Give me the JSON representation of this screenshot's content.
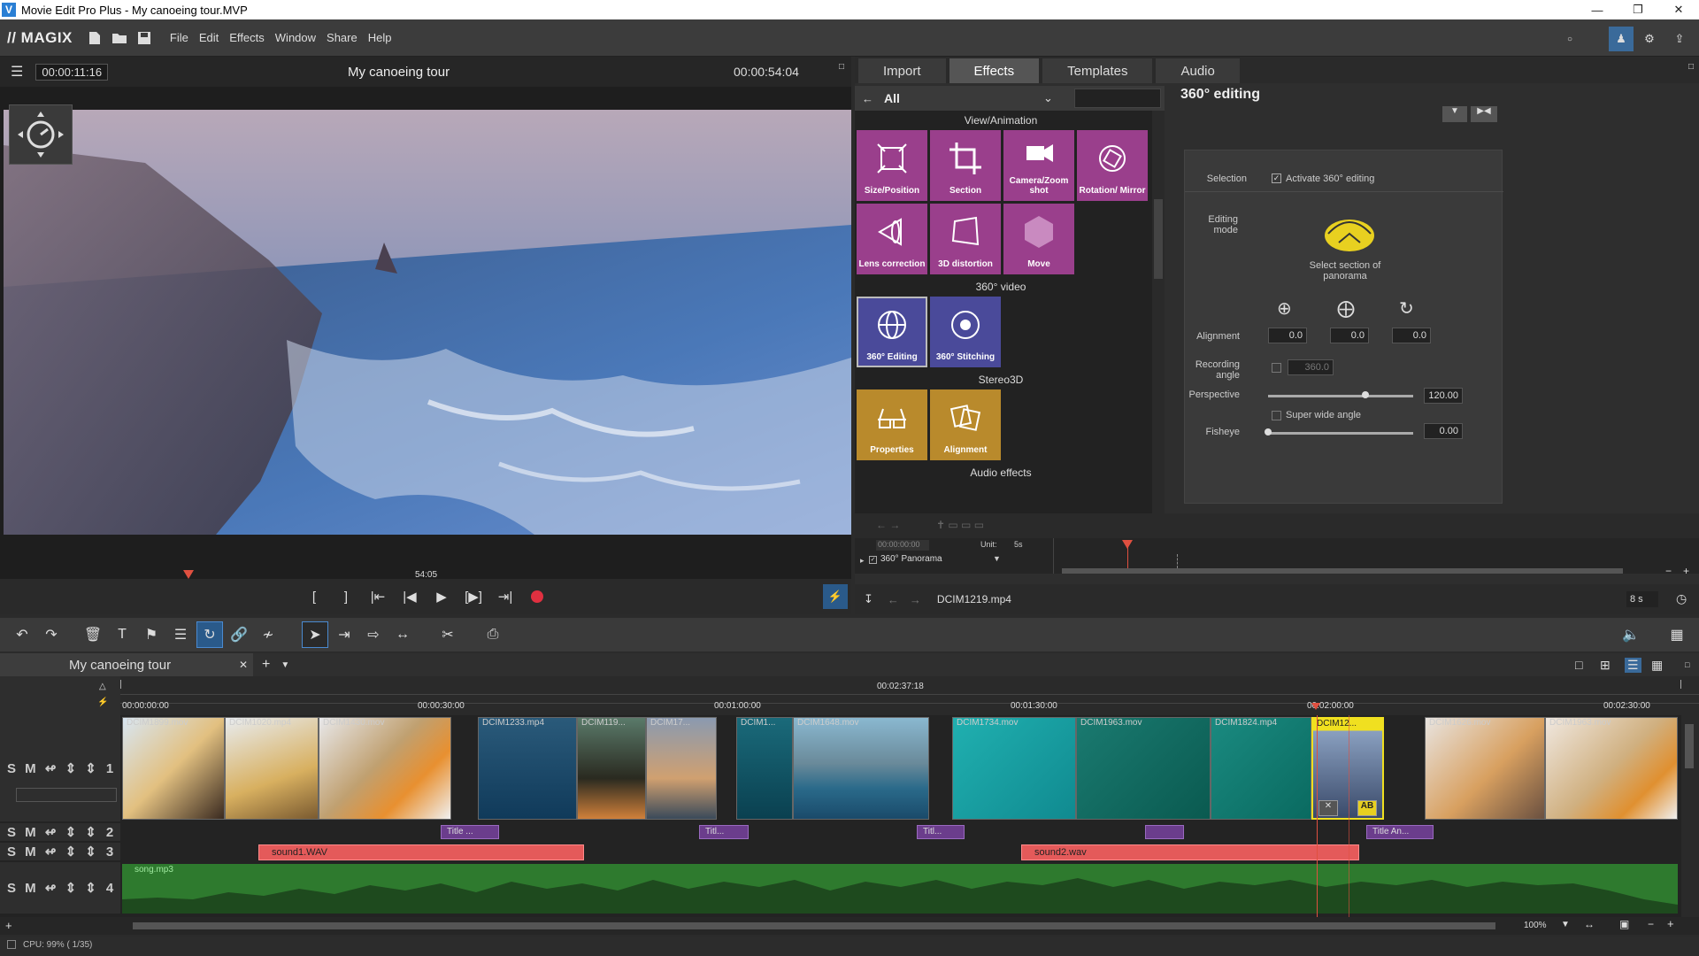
{
  "window": {
    "title": "Movie Edit Pro Plus - My canoeing tour.MVP"
  },
  "menu": {
    "logo": "// MAGIX",
    "items": [
      "File",
      "Edit",
      "Effects",
      "Window",
      "Share",
      "Help"
    ]
  },
  "preview": {
    "timecode_left": "00:00:11:16",
    "title": "My canoeing tour",
    "timecode_right": "00:00:54:04",
    "scrub_label": "54:05"
  },
  "media_tabs": [
    "Import",
    "Effects",
    "Templates",
    "Audio"
  ],
  "effects": {
    "category": "All",
    "sections": {
      "view": "View/Animation",
      "video360": "360° video",
      "stereo": "Stereo3D",
      "audio": "Audio effects"
    },
    "view_items": [
      "Size/Position",
      "Section",
      "Camera/Zoom shot",
      "Rotation/ Mirror",
      "Lens correction",
      "3D distortion",
      "Move"
    ],
    "video360_items": [
      "360° Editing",
      "360° Stitching"
    ],
    "stereo_items": [
      "Properties",
      "Alignment"
    ]
  },
  "editing360": {
    "title": "360° editing",
    "selection_label": "Selection",
    "activate_label": "Activate 360° editing",
    "editing_mode_label": "Editing mode",
    "select_section_label": "Select section of panorama",
    "alignment_label": "Alignment",
    "alignment_values": [
      "0.0",
      "0.0",
      "0.0"
    ],
    "recording_angle_label": "Recording angle",
    "recording_angle_value": "360.0",
    "perspective_label": "Perspective",
    "perspective_value": "120.00",
    "perspective_fraction": 0.67,
    "super_wide_label": "Super wide angle",
    "fisheye_label": "Fisheye",
    "fisheye_value": "0.00",
    "fisheye_fraction": 0.0
  },
  "keyframes": {
    "timecode": "00:00:00:00",
    "unit_label": "Unit:",
    "unit_value": "5s",
    "track_label": "360° Panorama"
  },
  "clip_info": {
    "name": "DCIM1219.mp4",
    "duration": "8 s"
  },
  "project": {
    "tab": "My canoeing tour"
  },
  "timeline": {
    "total": "00:02:37:18",
    "ticks": [
      "00:00:00:00",
      "00:00:30:00",
      "00:01:00:00",
      "00:01:30:00",
      "00:02:00:00",
      "00:02:30:00"
    ],
    "track_numbers": [
      "1",
      "2",
      "3",
      "4"
    ],
    "video_clips": [
      "DCIM1899.mov",
      "DCIM1020.mp4",
      "DCIM1430.mov",
      "DCIM1233.mp4",
      "DCIM119...",
      "DCIM17...",
      "DCIM1...",
      "DCIM1648.mov",
      "DCIM1734.mov",
      "DCIM1963.mov",
      "DCIM1824.mp4",
      "DCIM12...",
      "DCIM1626.mov",
      "DCIM1963.mov"
    ],
    "title_clips": [
      "Title ...",
      "Titl...",
      "Titl...",
      "",
      "Title  An..."
    ],
    "audio_clips": [
      "sound1.WAV",
      "sound2.wav"
    ],
    "music_clip": "song.mp3",
    "zoom": "100%"
  },
  "status": {
    "cpu": "CPU: 99% ( 1/35)"
  }
}
